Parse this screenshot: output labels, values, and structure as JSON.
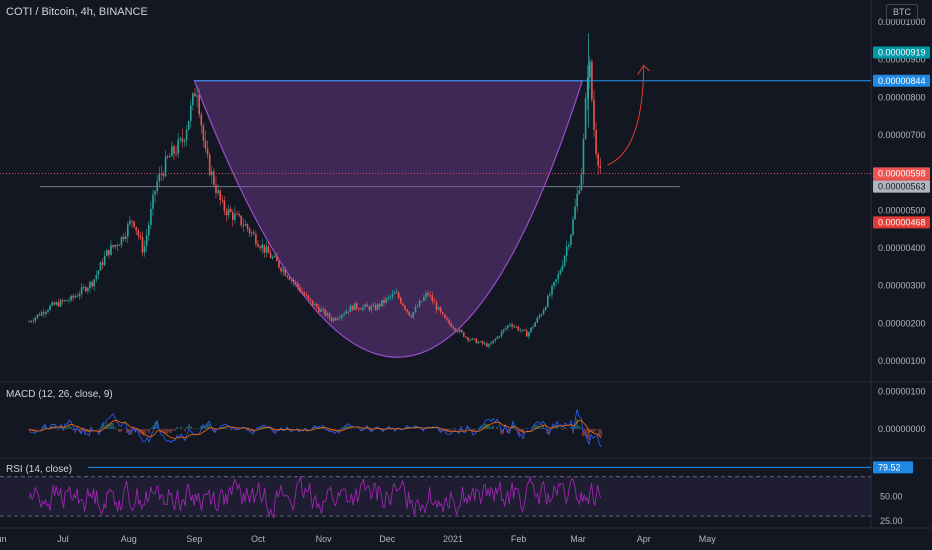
{
  "header": {
    "symbol_title": "COTI / Bitcoin, 4h, BINANCE",
    "currency": "BTC"
  },
  "colors": {
    "background": "#131722",
    "bull": "#26a69a",
    "bear": "#ef5350",
    "pattern_fill": "#7b3fa0",
    "resistance_line": "#2196f3",
    "target_zone": "#1e4d4a",
    "stop_zone": "#5a2428",
    "macd_line": "#2962ff",
    "signal_line": "#ff6d00",
    "rsi_line": "#9c27b0"
  },
  "chart_data": [
    {
      "type": "candlestick",
      "title": "COTI / Bitcoin, 4h, BINANCE",
      "x_ticks": [
        "Jul",
        "Aug",
        "Sep",
        "Oct",
        "Nov",
        "Dec",
        "2021",
        "Feb",
        "Mar",
        "Apr",
        "May",
        "Jun"
      ],
      "y_ticks": [
        "0.00001000",
        "0.00000900",
        "0.00000800",
        "0.00000700",
        "0.00000500",
        "0.00000400",
        "0.00000300",
        "0.00000200",
        "0.00000100"
      ],
      "ylim": [
        6e-07,
        1.04e-05
      ],
      "path_points": [
        [
          "Jun 15",
          2.05e-06
        ],
        [
          "Jun 25",
          2.45e-06
        ],
        [
          "Jul 5",
          2.65e-06
        ],
        [
          "Jul 15",
          3.1e-06
        ],
        [
          "Jul 22",
          3.9e-06
        ],
        [
          "Jul 28",
          4.2e-06
        ],
        [
          "Aug 3",
          4.8e-06
        ],
        [
          "Aug 8",
          3.9e-06
        ],
        [
          "Aug 14",
          5.7e-06
        ],
        [
          "Aug 20",
          6.4e-06
        ],
        [
          "Aug 26",
          6.8e-06
        ],
        [
          "Aug 31",
          7.8e-06
        ],
        [
          "Sep 2",
          8.4e-06
        ],
        [
          "Sep 6",
          6.5e-06
        ],
        [
          "Sep 14",
          5.1e-06
        ],
        [
          "Sep 25",
          4.6e-06
        ],
        [
          "Oct 5",
          3.9e-06
        ],
        [
          "Oct 15",
          3.3e-06
        ],
        [
          "Oct 25",
          2.6e-06
        ],
        [
          "Nov 5",
          2.1e-06
        ],
        [
          "Nov 15",
          2.45e-06
        ],
        [
          "Nov 25",
          2.4e-06
        ],
        [
          "Dec 5",
          2.8e-06
        ],
        [
          "Dec 12",
          2.2e-06
        ],
        [
          "Dec 20",
          2.8e-06
        ],
        [
          "Dec 28",
          2.1e-06
        ],
        [
          "Jan 8",
          1.6e-06
        ],
        [
          "Jan 18",
          1.4e-06
        ],
        [
          "Jan 28",
          2e-06
        ],
        [
          "Feb 5",
          1.7e-06
        ],
        [
          "Feb 12",
          2.3e-06
        ],
        [
          "Feb 20",
          3.3e-06
        ],
        [
          "Feb 26",
          4.5e-06
        ],
        [
          "Mar 3",
          6.2e-06
        ],
        [
          "Mar 6",
          9.2e-06
        ],
        [
          "Mar 9",
          6.8e-06
        ],
        [
          "Mar 12",
          6e-06
        ]
      ],
      "cup_handle": {
        "left_rim": [
          "Sep 1",
          8.44e-06
        ],
        "right_rim": [
          "Mar 3",
          8.44e-06
        ],
        "bottom": [
          "Dec 10",
          1.1e-06
        ]
      },
      "resistance_level": 8.44e-06,
      "position": {
        "target": 9.19e-06,
        "entry": 5.63e-06,
        "stop": 4.68e-06,
        "start": "Apr 18",
        "end": "Jun 20"
      },
      "price_tags": {
        "target": "0.00000919",
        "resistance": "0.00000844",
        "current": "0.00000598",
        "countdown": "01:08:40",
        "entry": "0.00000563",
        "stop": "0.00000468"
      }
    },
    {
      "type": "line",
      "title": "MACD (12, 26, close, 9)",
      "y_ticks": [
        "0.00000100",
        "0.00000000"
      ],
      "ylim": [
        -7e-07,
        1.1e-06
      ]
    },
    {
      "type": "line",
      "title": "RSI (14, close)",
      "y_ticks": [
        "50.00",
        "25.00"
      ],
      "levels": [
        70,
        30
      ],
      "ylim": [
        20,
        85
      ],
      "last_tag": "79.52"
    }
  ]
}
